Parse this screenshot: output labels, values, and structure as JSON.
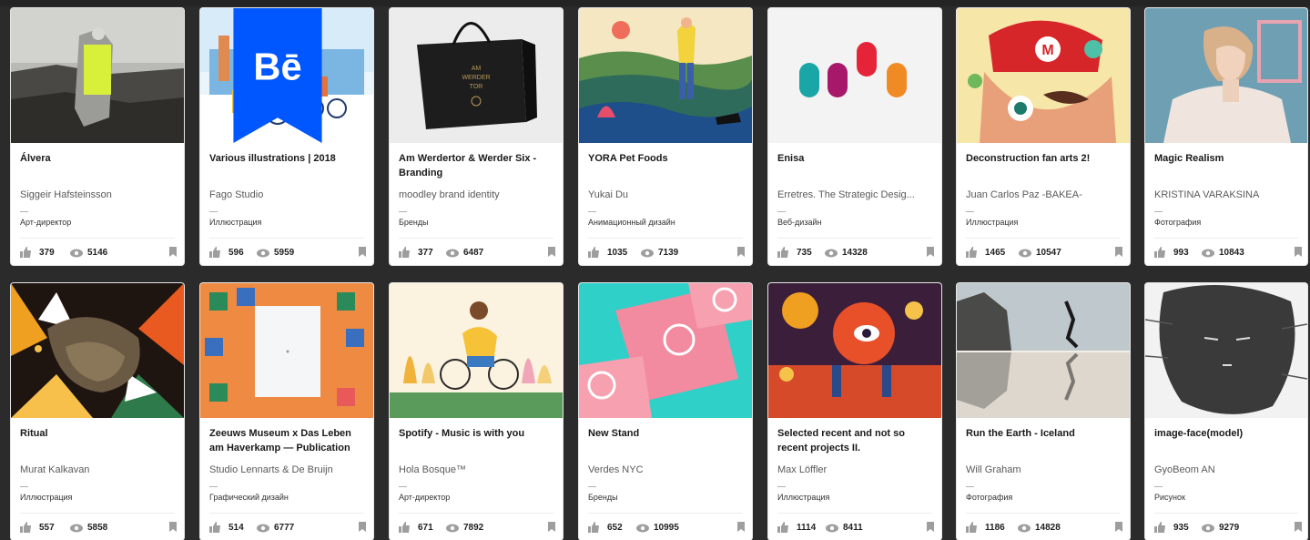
{
  "icons": {
    "appreciations": "thumbs-up-icon",
    "views": "eye-icon",
    "save": "bookmark-icon",
    "badge": "behance-badge-icon"
  },
  "colors": {
    "background": "#2b2b2b",
    "card": "#ffffff",
    "icon": "#9e9e9e",
    "behance_blue": "#0057ff"
  },
  "badge_text": "Bē",
  "projects": [
    {
      "title": "Álvera",
      "owner": "Siggeir Hafsteinsson",
      "field": "Арт-директор",
      "appreciations": "379",
      "views": "5146"
    },
    {
      "title": "Various illustrations | 2018",
      "owner": "Fago Studio",
      "field": "Иллюстрация",
      "appreciations": "596",
      "views": "5959"
    },
    {
      "title": "Am Werdertor & Werder Six - Branding",
      "owner": "moodley brand identity",
      "field": "Бренды",
      "appreciations": "377",
      "views": "6487"
    },
    {
      "title": "YORA Pet Foods",
      "owner": "Yukai Du",
      "field": "Анимационный дизайн",
      "appreciations": "1035",
      "views": "7139"
    },
    {
      "title": "Enisa",
      "owner": "Erretres. The Strategic Desig...",
      "field": "Веб-дизайн",
      "appreciations": "735",
      "views": "14328"
    },
    {
      "title": "Deconstruction fan arts 2!",
      "owner": "Juan Carlos Paz -BAKEA-",
      "field": "Иллюстрация",
      "appreciations": "1465",
      "views": "10547"
    },
    {
      "title": "Magic Realism",
      "owner": "KRISTINA VARAKSINA",
      "field": "Фотография",
      "appreciations": "993",
      "views": "10843"
    },
    {
      "title": "Ritual",
      "owner": "Murat Kalkavan",
      "field": "Иллюстрация",
      "appreciations": "557",
      "views": "5858"
    },
    {
      "title": "Zeeuws Museum x Das Leben am Haverkamp — Publication",
      "owner": "Studio Lennarts & De Bruijn",
      "field": "Графический дизайн",
      "appreciations": "514",
      "views": "6777"
    },
    {
      "title": "Spotify - Music is with you",
      "owner": "Hola Bosque™",
      "field": "Арт-директор",
      "appreciations": "671",
      "views": "7892"
    },
    {
      "title": "New Stand",
      "owner": "Verdes NYC",
      "field": "Бренды",
      "appreciations": "652",
      "views": "10995"
    },
    {
      "title": "Selected recent and not so recent projects II.",
      "owner": "Max Löffler",
      "field": "Иллюстрация",
      "appreciations": "1114",
      "views": "8411"
    },
    {
      "title": "Run the Earth - Iceland",
      "owner": "Will Graham",
      "field": "Фотография",
      "appreciations": "1186",
      "views": "14828"
    },
    {
      "title": "image-face(model)",
      "owner": "GyoBeom AN",
      "field": "Рисунок",
      "appreciations": "935",
      "views": "9279"
    }
  ]
}
